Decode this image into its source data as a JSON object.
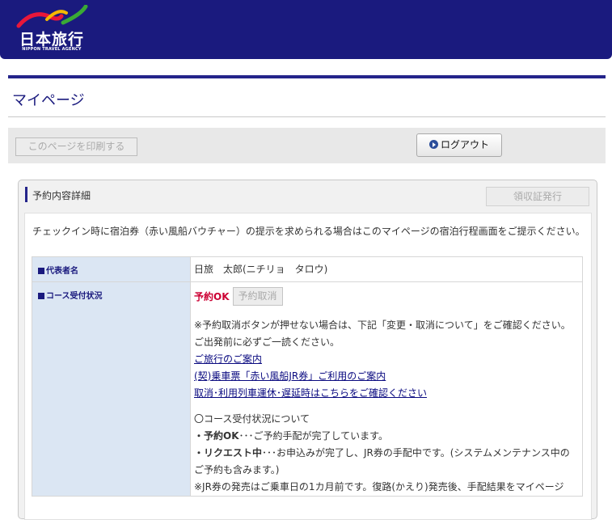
{
  "brand": {
    "name": "日本旅行",
    "tagline": "NIPPON TRAVEL AGENCY",
    "colors": {
      "header": "#1a1a7e",
      "swoosh_red": "#e8173a",
      "swoosh_yellow": "#f5b800",
      "swoosh_green": "#3aa935"
    }
  },
  "page": {
    "title": "マイページ"
  },
  "toolbar": {
    "print_label": "このページを印刷する",
    "logout_label": "ログアウト",
    "logout_icon": "play-circle-icon"
  },
  "panel": {
    "title": "予約内容詳細",
    "receipt_label": "領収証発行",
    "notice": "チェックイン時に宿泊券（赤い風船バウチャー）の提示を求められる場合はこのマイページの宿泊行程画面をご提示ください。"
  },
  "details": {
    "representative": {
      "label": "代表者名",
      "value": "日旅　太郎(ニチリョ　タロウ)"
    },
    "course_status": {
      "label": "コース受付状況",
      "status": "予約OK",
      "cancel_label": "予約取消",
      "note1": "※予約取消ボタンが押せない場合は、下記「変更・取消について」をご確認ください。",
      "note2": "ご出発前に必ずご一読ください。",
      "links": [
        "ご旅行のご案内",
        "(契)乗車票「赤い風船JR券」ご利用のご案内",
        "取消･利用列車運休･遅延時はこちらをご確認ください"
      ],
      "explain_heading": "〇コース受付状況について",
      "ok_term": "・予約OK",
      "ok_text": "･･･ご予約手配が完了しています。",
      "request_term": "・リクエスト中",
      "request_text": "･･･お申込みが完了し、JR券の手配中です。(システムメンテナンス中の",
      "request_text2": "ご予約も含みます。)",
      "jr_note": "※JR券の発売はご乗車日の1カ月前です。復路(かえり)発売後、手配結果をマイページ"
    }
  }
}
